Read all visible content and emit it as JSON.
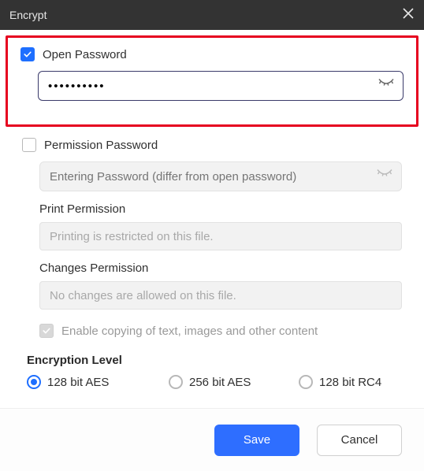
{
  "titlebar": {
    "title": "Encrypt"
  },
  "open_password": {
    "label": "Open Password",
    "value": "••••••••••",
    "checked": true
  },
  "permission_password": {
    "label": "Permission Password",
    "placeholder": "Entering Password (differ from open password)",
    "checked": false
  },
  "print_permission": {
    "label": "Print Permission",
    "value": "Printing is restricted on this file."
  },
  "changes_permission": {
    "label": "Changes Permission",
    "value": "No changes are allowed on this file."
  },
  "copy_option": {
    "label": "Enable copying of text, images and other content"
  },
  "encryption": {
    "title": "Encryption Level",
    "options": [
      "128 bit AES",
      "256 bit AES",
      "128 bit RC4"
    ],
    "selected": 0
  },
  "footer": {
    "save": "Save",
    "cancel": "Cancel"
  }
}
